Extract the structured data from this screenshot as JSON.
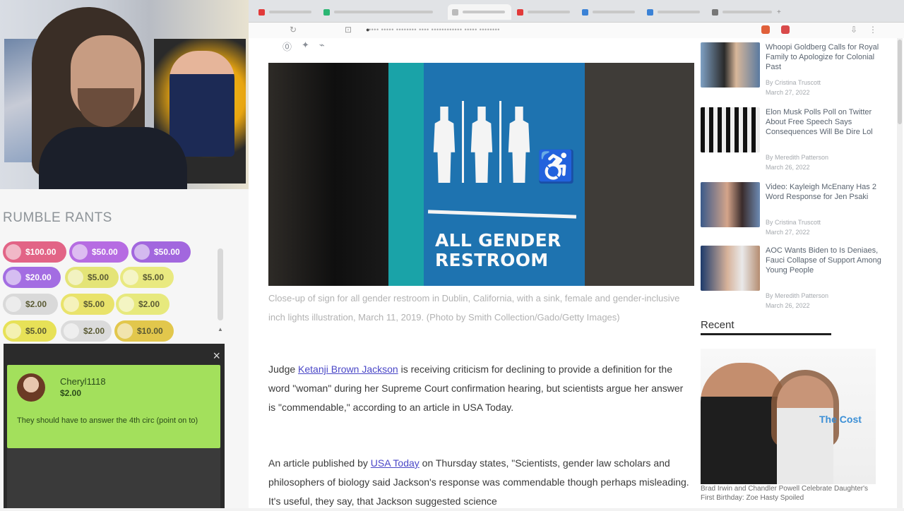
{
  "stream": {
    "rants_title": "RUMBLE RANTS",
    "rants": [
      {
        "amount": "$100.00",
        "color": "#e0557a"
      },
      {
        "amount": "$50.00",
        "color": "#b05ee0"
      },
      {
        "amount": "$50.00",
        "color": "#9a58dc"
      },
      {
        "amount": "$20.00",
        "color": "#9b5fe0"
      },
      {
        "amount": "$5.00",
        "color": "#e3e36a"
      },
      {
        "amount": "$5.00",
        "color": "#e8e874"
      },
      {
        "amount": "$2.00",
        "color": "#d6d6d6"
      },
      {
        "amount": "$5.00",
        "color": "#e8e25c"
      },
      {
        "amount": "$2.00",
        "color": "#e6e870"
      },
      {
        "amount": "$5.00",
        "color": "#e6df46"
      },
      {
        "amount": "$2.00",
        "color": "#d9d9d9"
      },
      {
        "amount": "$10.00",
        "color": "#e0c23a"
      }
    ],
    "chat": {
      "close": "×",
      "username": "Cheryl1118",
      "amount": "$2.00",
      "message": "They should have to answer the 4th circ (point on to)"
    }
  },
  "browser": {
    "address": "•••• ••••• •••••••• •••• •••••••••••• ••••• ••••••••",
    "share_icons": [
      "rumble-icon",
      "twitter-icon",
      "link-icon"
    ],
    "hero_sign": {
      "line1": "ALL GENDER",
      "line2": "RESTROOM"
    },
    "caption": "Close-up of sign for all gender restroom in Dublin, California, with a sink, female and gender-inclusive inch lights illustration, March 11, 2019. (Photo by Smith Collection/Gado/Getty Images)",
    "para1": {
      "before": "Judge ",
      "link": "Ketanji Brown Jackson",
      "after": " is receiving criticism for declining to provide a definition for the word \"woman\" during her Supreme Court confirmation hearing, but scientists argue her answer is \"commendable,\" according to an article in USA Today."
    },
    "para2": {
      "before": "An article published by ",
      "link": "USA Today",
      "after": " on Thursday states, \"Scientists, gender law scholars and philosophers of biology said Jackson's response was commendable though perhaps misleading. It's useful, they say, that Jackson suggested science"
    },
    "sidebar": [
      {
        "title": "Whoopi Goldberg Calls for Royal Family to Apologize for Colonial Past",
        "meta1": "By Cristina Truscott",
        "meta2": "March 27, 2022"
      },
      {
        "title": "Elon Musk Polls Poll on Twitter About Free Speech Says Consequences Will Be Dire Lol",
        "meta1": "By Meredith Patterson",
        "meta2": "March 26, 2022"
      },
      {
        "title": "Video: Kayleigh McEnany Has 2 Word Response for Jen Psaki",
        "meta1": "By Cristina Truscott",
        "meta2": "March 27, 2022"
      },
      {
        "title": "AOC Wants Biden to Is Deniaes, Fauci Collapse of Support Among Young People",
        "meta1": "By Meredith Patterson",
        "meta2": "March 26, 2022"
      }
    ],
    "recent_label": "Recent",
    "recent_brand": "The Cost",
    "recent_caption": "Brad Irwin and Chandler Powell Celebrate Daughter's First Birthday: Zoe Hasty Spoiled"
  }
}
